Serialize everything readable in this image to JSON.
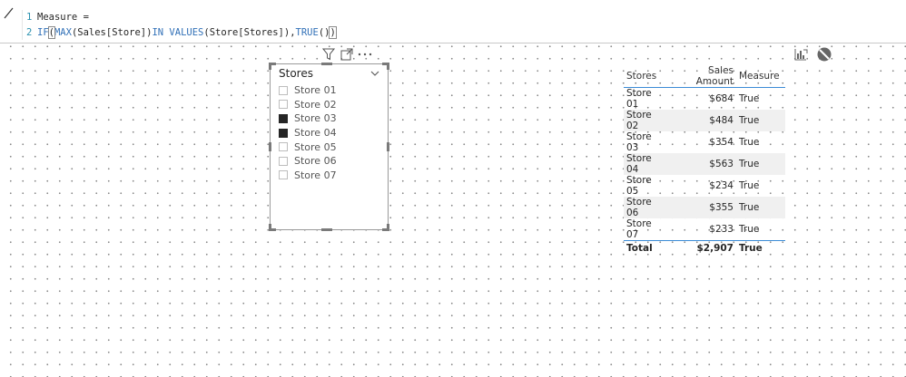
{
  "formula": {
    "lines": [
      {
        "num": "1",
        "text": "Measure ="
      },
      {
        "num": "2",
        "seg1": "IF",
        "seg2": "(",
        "seg3": "MAX",
        "seg4": "(Sales[Store])",
        "seg5": "IN VALUES",
        "seg6": "(Store[Stores]),",
        "seg7": "TRUE",
        "seg8": "()",
        "seg9": ")"
      }
    ]
  },
  "slicer": {
    "title": "Stores",
    "items": [
      {
        "label": "Store 01",
        "checked": false
      },
      {
        "label": "Store 02",
        "checked": false
      },
      {
        "label": "Store 03",
        "checked": true
      },
      {
        "label": "Store 04",
        "checked": true
      },
      {
        "label": "Store 05",
        "checked": false
      },
      {
        "label": "Store 06",
        "checked": false
      },
      {
        "label": "Store 07",
        "checked": false
      }
    ]
  },
  "table": {
    "headers": [
      "Stores",
      "Sales Amount",
      "Measure"
    ],
    "rows": [
      [
        "Store 01",
        "$684",
        "True"
      ],
      [
        "Store 02",
        "$484",
        "True"
      ],
      [
        "Store 03",
        "$354",
        "True"
      ],
      [
        "Store 04",
        "$563",
        "True"
      ],
      [
        "Store 05",
        "$234",
        "True"
      ],
      [
        "Store 06",
        "$355",
        "True"
      ],
      [
        "Store 07",
        "$233",
        "True"
      ]
    ],
    "total": [
      "Total",
      "$2,907",
      "True"
    ]
  },
  "icons": {
    "formula": "formula-edit-icon",
    "filter": "filter-icon",
    "focus": "focus-mode-icon",
    "more": "more-options-icon",
    "chevron": "chevron-down-icon",
    "drill": "drill-chart-icon",
    "blocked": "blocked-icon"
  },
  "colors": {
    "accent": "#3b8bd6",
    "checked": "#252525",
    "function": "#3170b7",
    "line_number": "#2b91af"
  }
}
